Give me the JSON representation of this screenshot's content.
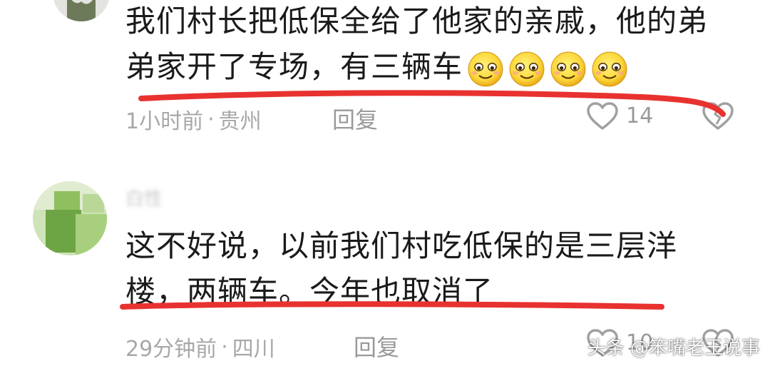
{
  "comments": [
    {
      "username": "",
      "text_line1": "我们村长把低保全给了他家的亲戚，他的弟",
      "text_line2": "弟家开了专场，有三辆车",
      "emoji_icon": "smiling-face-icon",
      "time": "1小时前",
      "separator": "·",
      "location": "贵州",
      "reply_label": "回复",
      "likes": "14"
    },
    {
      "username": "白性",
      "text_line1": "这不好说，以前我们村吃低保的是三层洋",
      "text_line2": "楼，两辆车。今年也取消了",
      "time": "29分钟前",
      "separator": "·",
      "location": "四川",
      "reply_label": "回复",
      "likes": "10"
    }
  ],
  "watermark": "头条 @笨嘴老王说事",
  "colors": {
    "underline": "#e8322f",
    "meta_text": "#a8a8a8",
    "body_text": "#1a1a1a"
  },
  "icons": [
    "heart-outline-icon",
    "broken-heart-icon",
    "smiling-face-icon"
  ]
}
